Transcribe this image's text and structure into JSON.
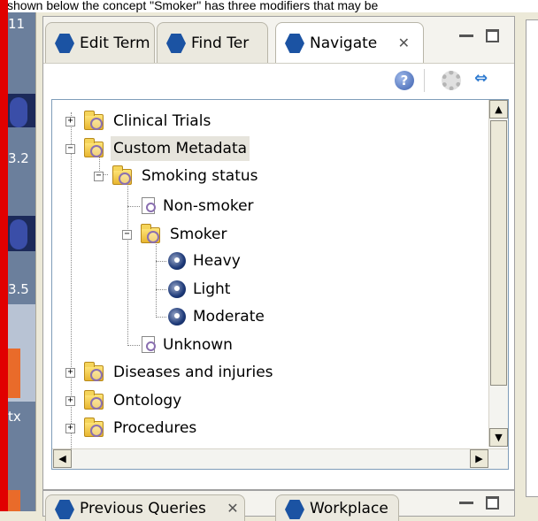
{
  "top_caption": "shown below the concept \"Smoker\" has three modifiers that may be",
  "left_strip_labels": [
    "11",
    "3.2",
    "3.5",
    "tx"
  ],
  "tabs": [
    {
      "label": "Edit Term"
    },
    {
      "label": "Find Ter"
    },
    {
      "label": "Navigate",
      "active": true
    }
  ],
  "tab_close_glyph": "✕",
  "toolbar": {
    "help": "?",
    "link": "⇔"
  },
  "tree": [
    {
      "label": "Clinical Trials",
      "type": "folder",
      "level": 0,
      "expanded": false
    },
    {
      "label": "Custom Metadata",
      "type": "folder",
      "level": 0,
      "expanded": true,
      "selected": true
    },
    {
      "label": "Smoking status",
      "type": "folder",
      "level": 1,
      "expanded": true
    },
    {
      "label": "Non-smoker",
      "type": "concept",
      "level": 2
    },
    {
      "label": "Smoker",
      "type": "folder",
      "level": 2,
      "expanded": true
    },
    {
      "label": "Heavy",
      "type": "modifier",
      "level": 3
    },
    {
      "label": "Light",
      "type": "modifier",
      "level": 3
    },
    {
      "label": "Moderate",
      "type": "modifier",
      "level": 3
    },
    {
      "label": "Unknown",
      "type": "concept",
      "level": 2
    },
    {
      "label": "Diseases and injuries",
      "type": "folder",
      "level": 0,
      "expanded": false
    },
    {
      "label": "Ontology",
      "type": "folder",
      "level": 0,
      "expanded": false
    },
    {
      "label": "Procedures",
      "type": "folder",
      "level": 0,
      "expanded": false
    }
  ],
  "bottom_tabs": [
    {
      "label": "Previous Queries"
    },
    {
      "label": "Workplace"
    }
  ],
  "colors": {
    "hex_icon": "#1b53a3",
    "selection": "#e6e4dc",
    "side_bar": "#e10000"
  }
}
